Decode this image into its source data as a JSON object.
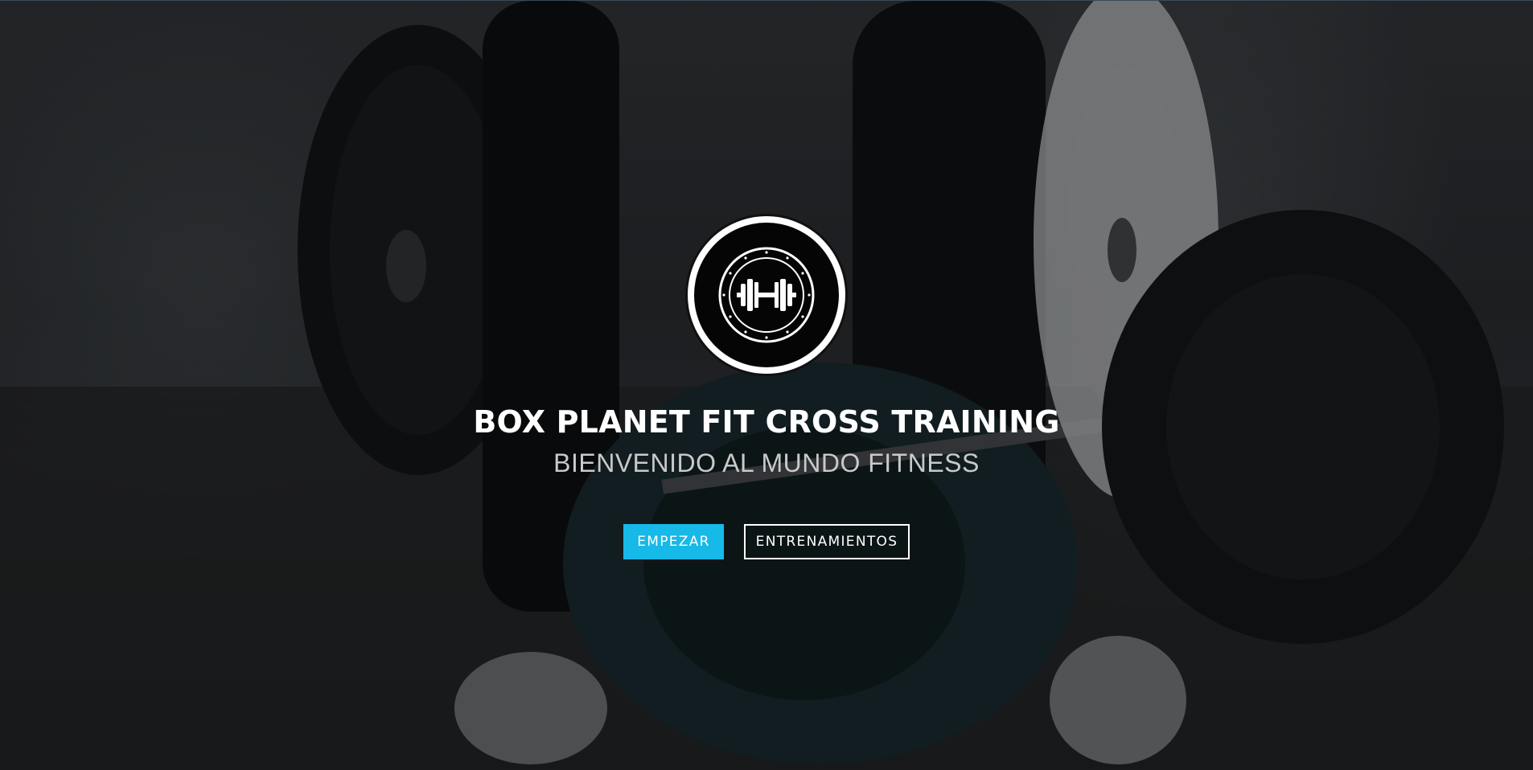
{
  "hero": {
    "title": "BOX PLANET FIT CROSS TRAINING",
    "subtitle": "BIENVENIDO AL MUNDO FITNESS",
    "logo_icon": "dumbbell-icon",
    "buttons": {
      "primary_label": "EMPEZAR",
      "secondary_label": "ENTRENAMIENTOS"
    }
  },
  "colors": {
    "accent": "#16b9e7",
    "text": "#ffffff",
    "subtitle": "#c9c9c9",
    "background": "#1b1d1f"
  }
}
